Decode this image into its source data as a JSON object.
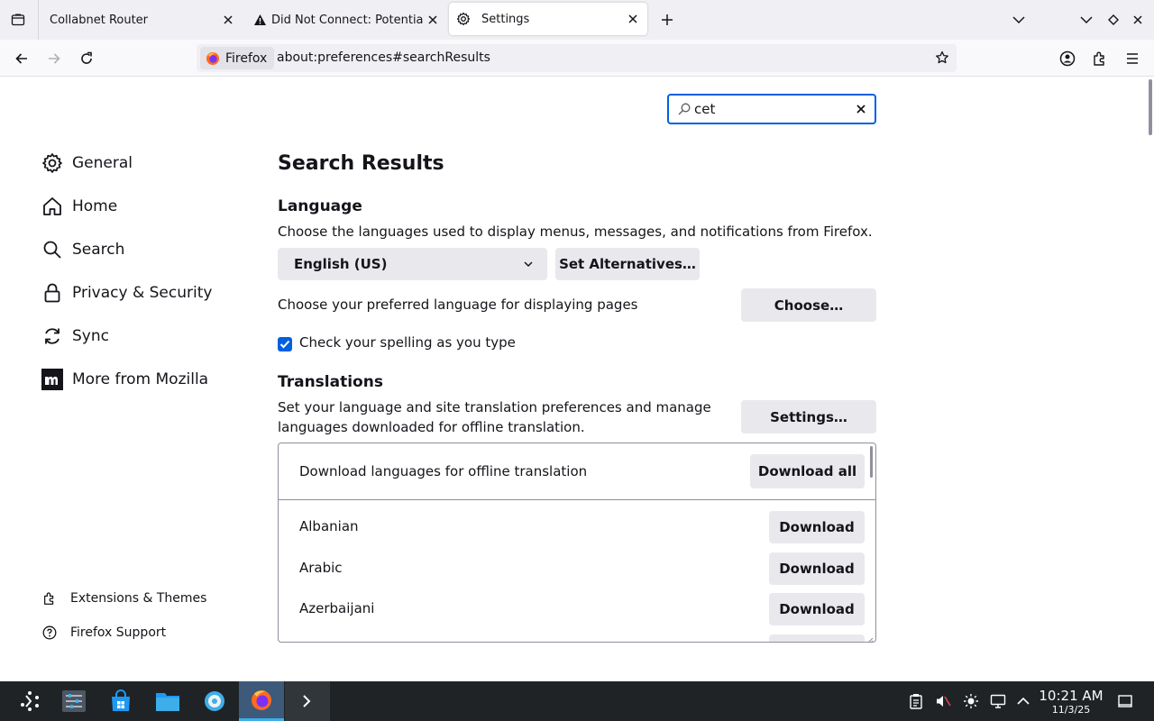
{
  "tabs": [
    {
      "label": "Collabnet Router",
      "icon": "none"
    },
    {
      "label": "Did Not Connect: Potential",
      "icon": "warning-icon"
    },
    {
      "label": "Settings",
      "icon": "gear-icon"
    }
  ],
  "urlbar": {
    "identity": "Firefox",
    "url": "about:preferences#searchResults"
  },
  "search": {
    "value": "cet"
  },
  "sidebar": {
    "categories": [
      {
        "label": "General",
        "icon": "gear-icon"
      },
      {
        "label": "Home",
        "icon": "home-icon"
      },
      {
        "label": "Search",
        "icon": "search-icon"
      },
      {
        "label": "Privacy & Security",
        "icon": "lock-icon"
      },
      {
        "label": "Sync",
        "icon": "sync-icon"
      },
      {
        "label": "More from Mozilla",
        "icon": "mozilla-icon"
      }
    ],
    "footer": [
      {
        "label": "Extensions & Themes",
        "icon": "puzzle-icon"
      },
      {
        "label": "Firefox Support",
        "icon": "help-icon"
      }
    ]
  },
  "main": {
    "title": "Search Results",
    "language": {
      "heading": "Language",
      "description": "Choose the languages used to display menus, messages, and notifications from Firefox.",
      "selected_language": "English (US)",
      "set_alternatives": "Set Alternatives…",
      "page_lang_label": "Choose your preferred language for displaying pages",
      "choose_button": "Choose…",
      "spellcheck_label": "Check your spelling as you type",
      "spellcheck_checked": true
    },
    "translations": {
      "heading": "Translations",
      "description_line1": "Set your language and site translation preferences and manage",
      "description_line2": "languages downloaded for offline translation.",
      "settings_button": "Settings…",
      "download_header": "Download languages for offline translation",
      "download_all": "Download all",
      "languages": [
        {
          "name": "Albanian",
          "action": "Download"
        },
        {
          "name": "Arabic",
          "action": "Download"
        },
        {
          "name": "Azerbaijani",
          "action": "Download"
        }
      ]
    }
  },
  "taskbar": {
    "time": "10:21 AM",
    "date": "11/3/25"
  },
  "colors": {
    "accent": "#0061e0",
    "taskbar_bg": "#202326",
    "button_bg": "#e9e9ed"
  }
}
